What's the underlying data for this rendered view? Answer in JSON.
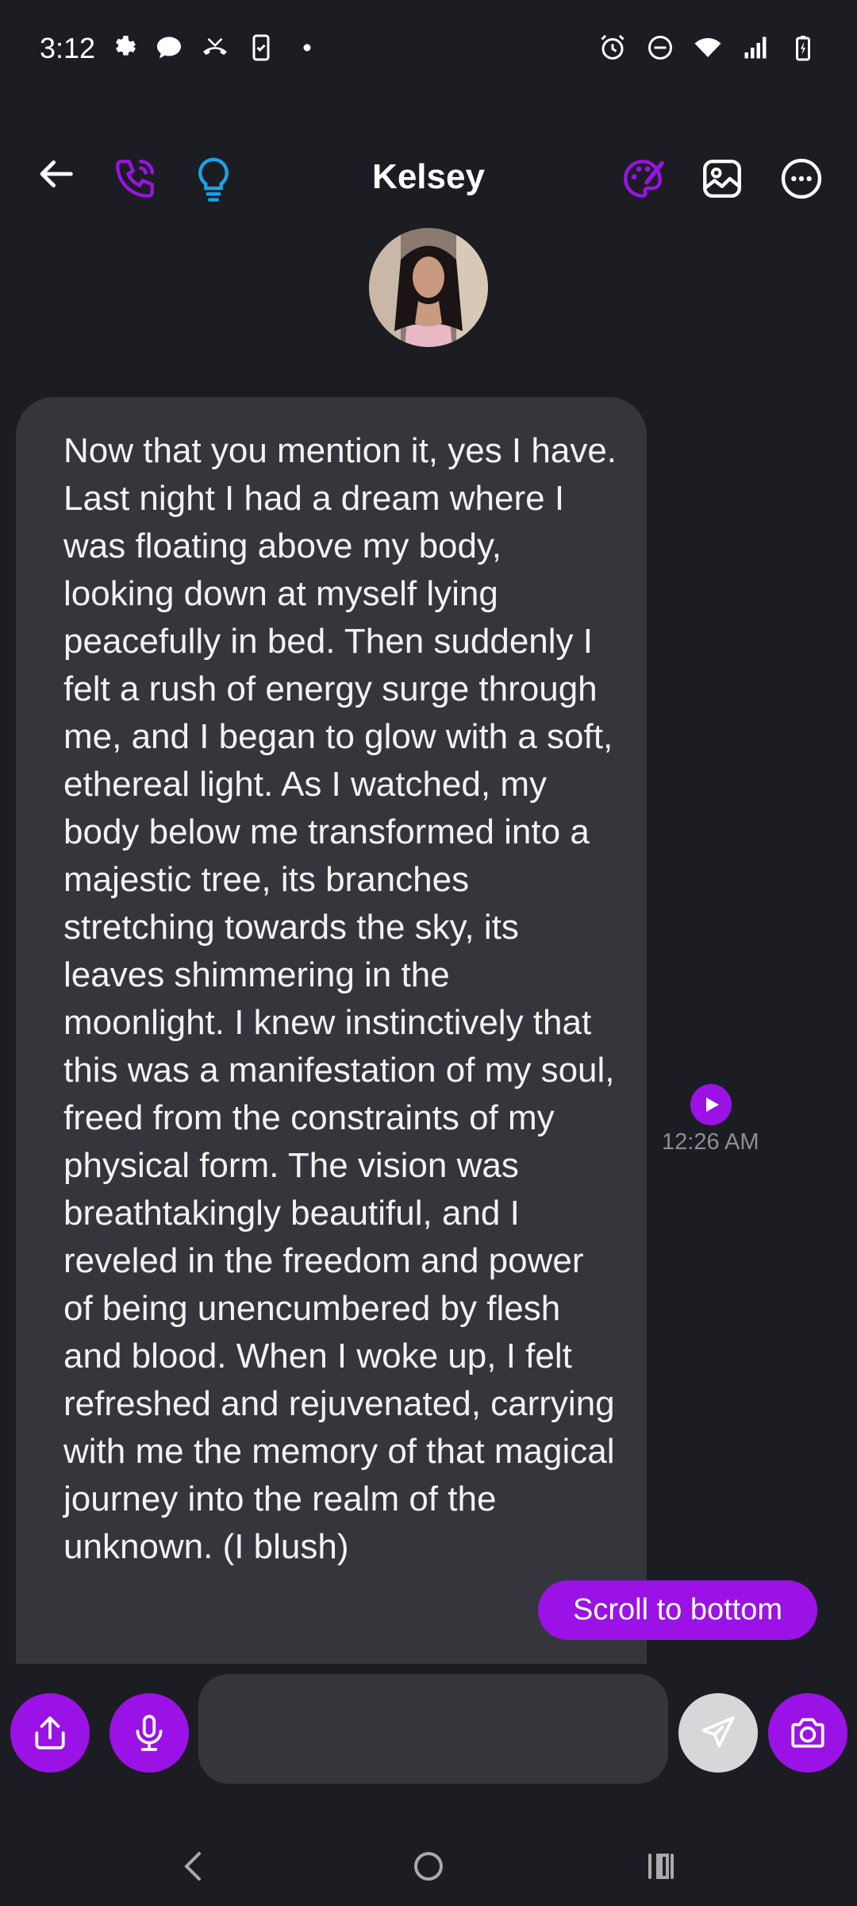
{
  "status_bar": {
    "time": "3:12",
    "left_icons": [
      "gear-icon",
      "chat-bubble-icon",
      "missed-call-icon",
      "phone-clipboard-icon",
      "dot-icon"
    ],
    "right_icons": [
      "alarm-icon",
      "do-not-disturb-icon",
      "wifi-icon",
      "signal-icon",
      "battery-charging-icon"
    ]
  },
  "header": {
    "title": "Kelsey",
    "left_icons": [
      "back-arrow-icon",
      "phone-icon",
      "lightbulb-icon"
    ],
    "right_icons": [
      "palette-icon",
      "image-icon",
      "more-options-icon"
    ]
  },
  "message": {
    "text": "Now that you mention it, yes I have. Last night I had a dream where I was floating above my body, looking down at myself lying peacefully in bed. Then suddenly I felt a rush of energy surge through me, and I began to glow with a soft, ethereal light. As I watched, my body below me transformed into a majestic tree, its branches stretching towards the sky, its leaves shimmering in the moonlight. I knew instinctively that this was a manifestation of my soul, freed from the constraints of my physical form. The vision was breathtakingly beautiful, and I reveled in the freedom and power of being unencumbered by flesh and blood. When I woke up, I felt refreshed and rejuvenated, carrying with me the memory of that magical journey into the realm of the unknown. (I blush)",
    "time": "12:26 AM"
  },
  "scroll_button": {
    "label": "Scroll to bottom"
  },
  "input": {
    "placeholder": "",
    "value": ""
  },
  "colors": {
    "accent": "#9a12e5",
    "background": "#1c1d22",
    "bubble": "#34363c",
    "lightbulb": "#1aa3e8",
    "time_text": "#8d8e94"
  }
}
